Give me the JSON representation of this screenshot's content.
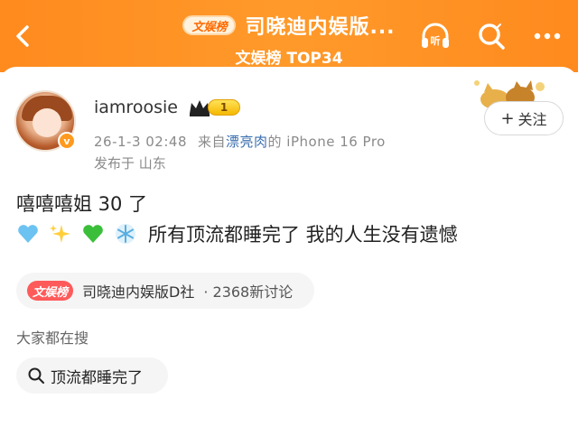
{
  "header": {
    "title": "司晓迪内娱版...",
    "subtitle": "文娱榜 TOP34",
    "logo_text": "文娱榜",
    "back_icon": "chevron-left-icon",
    "listen_icon": "headphones-icon",
    "listen_label": "听",
    "search_icon": "search-icon",
    "more_icon": "more-dots-icon"
  },
  "post": {
    "username": "iamroosie",
    "level": "1",
    "verified_mark": "v",
    "time": "26-1-3 02:48",
    "source_prefix": "来自",
    "source_highlight": "漂亮肉",
    "source_suffix": "的 iPhone 16 Pro",
    "location": "发布于 山东",
    "follow_label": "关注",
    "line1": "嘻嘻嘻姐 30 了",
    "emojis": [
      "blue-heart-icon",
      "sparkles-icon",
      "green-heart-icon",
      "snowflake-icon"
    ],
    "line2": "所有顶流都睡完了 我的人生没有遗憾"
  },
  "topic": {
    "logo_text": "文娱榜",
    "name": "司晓迪内娱版D社",
    "count": "· 2368新讨论"
  },
  "search": {
    "heading": "大家都在搜",
    "query": "顶流都睡完了"
  },
  "colors": {
    "header_orange": "#ff8a1e",
    "link_blue": "#3b6fb0",
    "meta_gray": "#8a8a8a"
  }
}
